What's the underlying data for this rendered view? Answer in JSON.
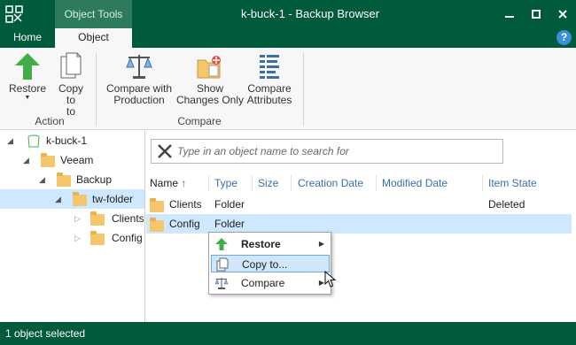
{
  "window": {
    "title": "k-buck-1 - Backup Browser",
    "contextual_tab_header": "Object Tools"
  },
  "tabs": {
    "home": "Home",
    "object": "Object",
    "help": "?"
  },
  "ribbon": {
    "restore": "Restore",
    "copy": "Copy to",
    "action_group": "Action",
    "compare_with_production": "Compare with Production",
    "show_changes_only": "Show Changes Only",
    "compare_attributes": "Compare Attributes",
    "compare_group": "Compare"
  },
  "tree": {
    "root": "k-buck-1",
    "veeam": "Veeam",
    "backup": "Backup",
    "tw_folder": "tw-folder",
    "clients": "Clients",
    "config": "Config"
  },
  "search": {
    "placeholder": "Type in an object name to search for"
  },
  "columns": {
    "name": "Name",
    "type": "Type",
    "size": "Size",
    "creation_date": "Creation Date",
    "modified_date": "Modified Date",
    "item_state": "Item State"
  },
  "rows": [
    {
      "name": "Clients",
      "type": "Folder",
      "size": "",
      "creation_date": "",
      "modified_date": "",
      "item_state": "Deleted"
    },
    {
      "name": "Config",
      "type": "Folder",
      "size": "",
      "creation_date": "",
      "modified_date": "",
      "item_state": ""
    }
  ],
  "context_menu": {
    "restore": "Restore",
    "copy_to": "Copy to...",
    "compare": "Compare"
  },
  "status": {
    "text": "1 object selected"
  },
  "colors": {
    "brand": "#005a3c",
    "selection": "#cde8ff"
  }
}
